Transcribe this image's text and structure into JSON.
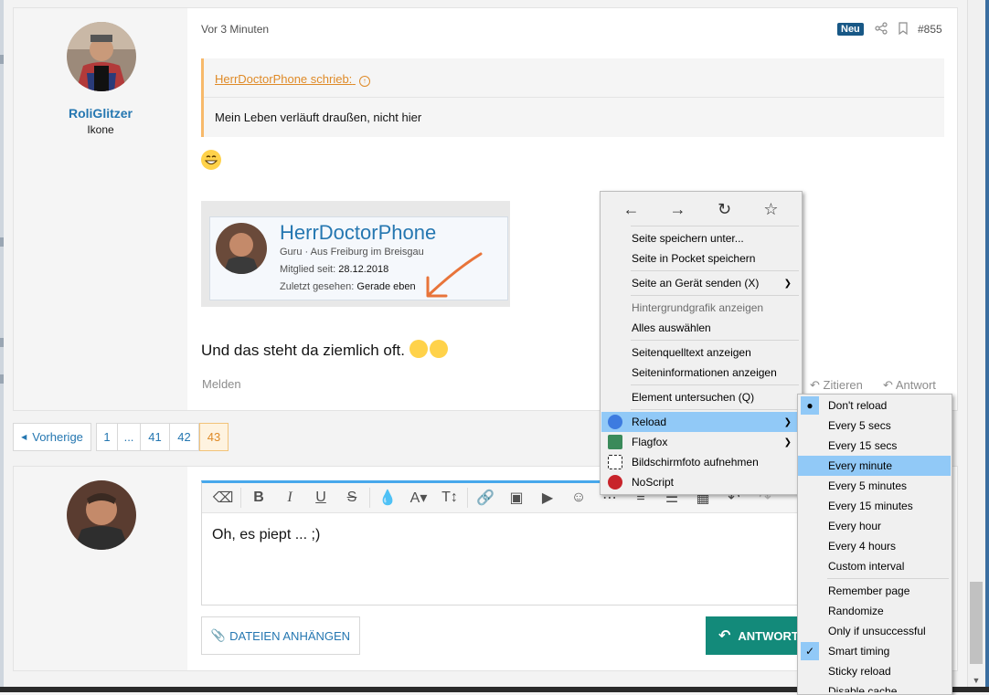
{
  "post": {
    "author_name": "RoliGlitzer",
    "author_title": "Ikone",
    "time": "Vor 3 Minuten",
    "new_badge": "Neu",
    "post_number": "#855",
    "quote_author": "HerrDoctorPhone schrieb:",
    "quote_text": "Mein Leben verläuft draußen, nicht hier",
    "embedded_card": {
      "name": "HerrDoctorPhone",
      "line1": "Guru · Aus Freiburg im Breisgau",
      "member_since_label": "Mitglied seit:",
      "member_since_value": "28.12.2018",
      "last_seen_label": "Zuletzt gesehen:",
      "last_seen_value": "Gerade eben"
    },
    "body_text": "Und das steht da ziemlich oft.",
    "report_label": "Melden",
    "quote_action": "Zitieren",
    "reply_action": "Antwort"
  },
  "pagination": {
    "prev_label": "Vorherige",
    "pages": [
      "1",
      "...",
      "41",
      "42",
      "43"
    ],
    "current": "43"
  },
  "reply": {
    "editor_text": "Oh, es piept ... ;)",
    "attach_label": "DATEIEN ANHÄNGEN",
    "submit_label": "ANTWORT"
  },
  "context_menu": {
    "items": [
      {
        "label": "Seite speichern unter...",
        "disabled": false
      },
      {
        "label": "Seite in Pocket speichern",
        "disabled": false
      },
      {
        "label": "Seite an Gerät senden (X)",
        "disabled": false,
        "submenu": true
      },
      {
        "label": "Hintergrundgrafik anzeigen",
        "disabled": true
      },
      {
        "label": "Alles auswählen",
        "disabled": false
      },
      {
        "label": "Seitenquelltext anzeigen",
        "disabled": false
      },
      {
        "label": "Seiteninformationen anzeigen",
        "disabled": false
      },
      {
        "label": "Element untersuchen (Q)",
        "disabled": false
      },
      {
        "label": "Reload",
        "submenu": true,
        "highlighted": true,
        "icon": "reload-addon-icon"
      },
      {
        "label": "Flagfox",
        "submenu": true,
        "icon": "flagfox-icon"
      },
      {
        "label": "Bildschirmfoto aufnehmen",
        "icon": "screenshot-icon"
      },
      {
        "label": "NoScript",
        "icon": "noscript-icon"
      }
    ]
  },
  "reload_submenu": {
    "items": [
      {
        "label": "Don't reload",
        "mark": "bullet"
      },
      {
        "label": "Every 5 secs"
      },
      {
        "label": "Every 15 secs"
      },
      {
        "label": "Every minute",
        "highlighted": true
      },
      {
        "label": "Every 5 minutes"
      },
      {
        "label": "Every 15 minutes"
      },
      {
        "label": "Every hour"
      },
      {
        "label": "Every 4 hours"
      },
      {
        "label": "Custom interval"
      },
      {
        "label": "Remember page"
      },
      {
        "label": "Randomize"
      },
      {
        "label": "Only if unsuccessful"
      },
      {
        "label": "Smart timing",
        "mark": "check"
      },
      {
        "label": "Sticky reload"
      },
      {
        "label": "Disable cache"
      }
    ]
  },
  "colors": {
    "link_blue": "#2577b1",
    "quote_orange": "#df8a27",
    "menu_highlight": "#91c9f7",
    "submit_green": "#138a7a"
  }
}
